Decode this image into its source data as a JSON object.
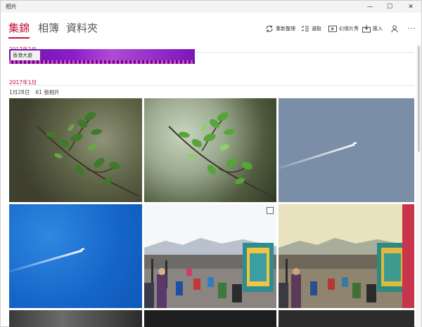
{
  "window": {
    "title": "相片",
    "controls": {
      "minimize": "—",
      "maximize": "☐",
      "close": "✕"
    }
  },
  "nav": {
    "tabs": [
      {
        "label": "集錦",
        "selected": true
      },
      {
        "label": "相簿",
        "selected": false
      },
      {
        "label": "資料夾",
        "selected": false
      }
    ],
    "accent": "#c50f3b"
  },
  "commands": {
    "refresh": {
      "label": "重新整理",
      "icon": "refresh-icon"
    },
    "select": {
      "label": "選取",
      "icon": "checklist-icon"
    },
    "slideshow": {
      "label": "幻燈片秀",
      "icon": "slideshow-icon"
    },
    "import": {
      "label": "匯入",
      "icon": "import-icon"
    },
    "account": {
      "icon": "person-icon"
    },
    "more": {
      "label": "···",
      "icon": "more-icon"
    }
  },
  "collection": {
    "groups": [
      {
        "month": "2017年2月"
      },
      {
        "month": "2017年1月",
        "date": "1月28日",
        "count": "61 張相片"
      }
    ],
    "banner_text": "香港大遊"
  }
}
